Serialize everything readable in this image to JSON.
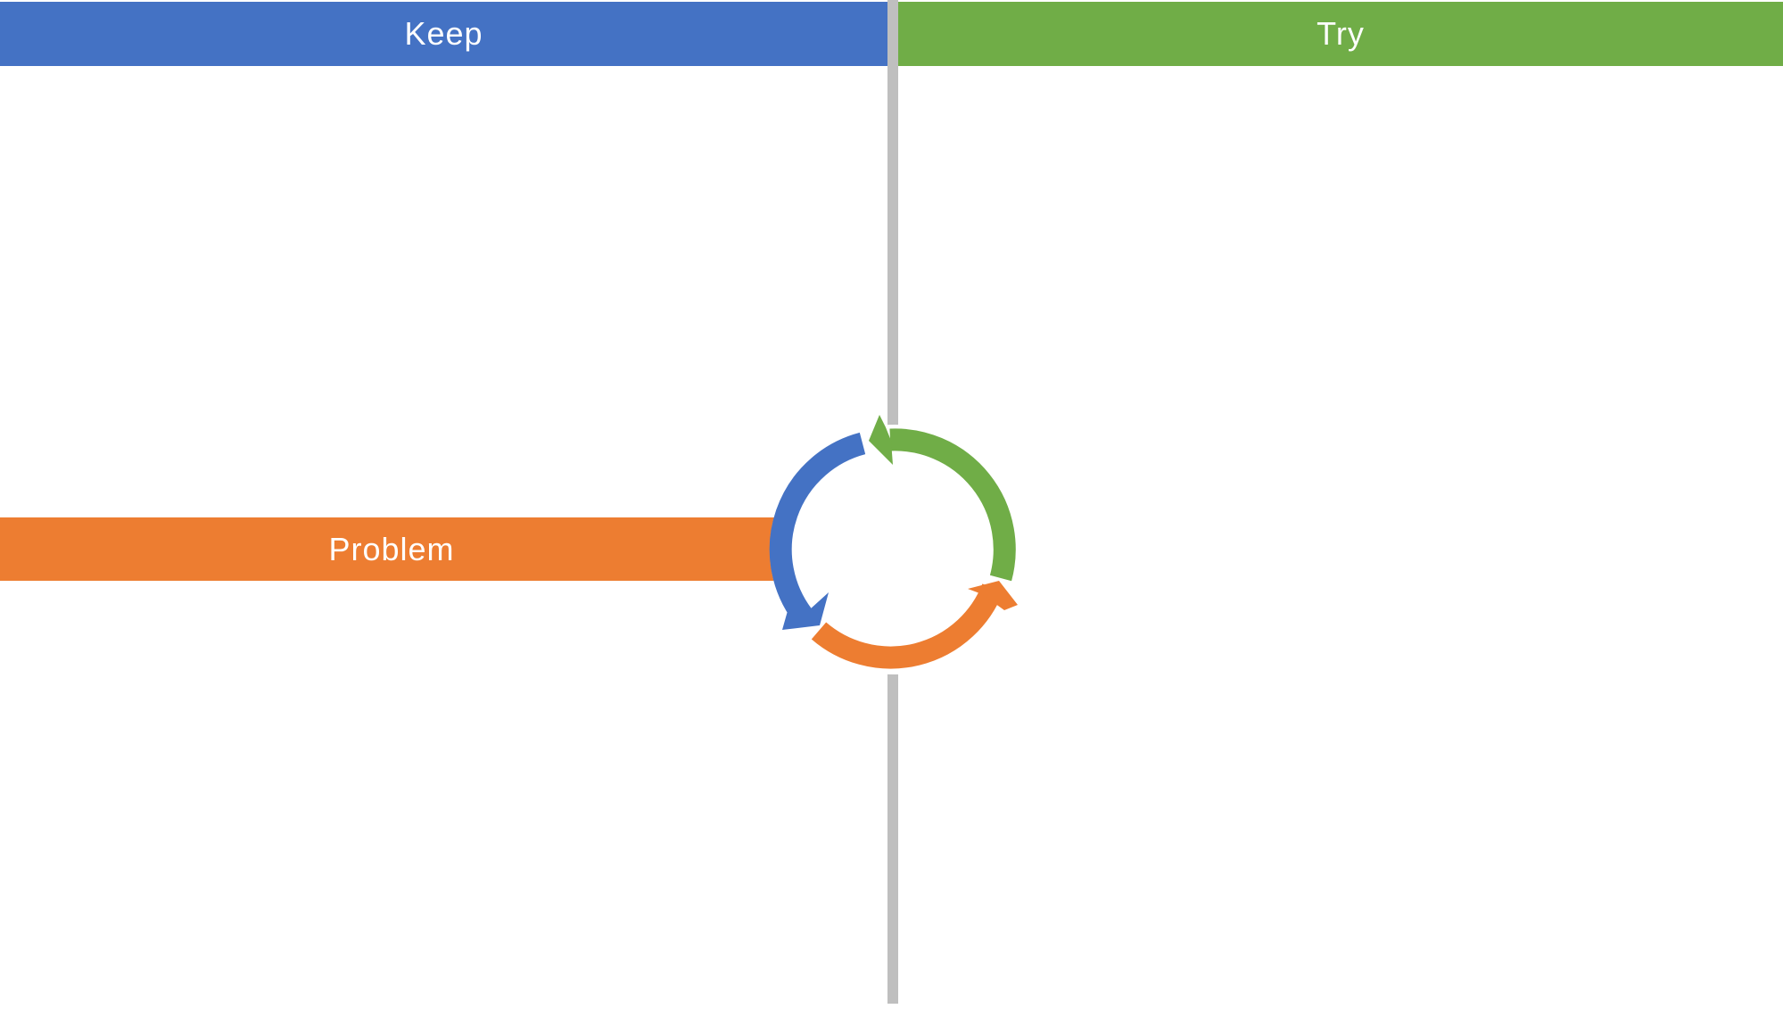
{
  "sections": {
    "keep": {
      "label": "Keep",
      "color": "#4472c4"
    },
    "try": {
      "label": "Try",
      "color": "#70ad47"
    },
    "problem": {
      "label": "Problem",
      "color": "#ed7d31"
    }
  },
  "divider": {
    "color": "#bfbfbf"
  },
  "cycle": {
    "arrows": [
      {
        "name": "keep-to-problem-arrow",
        "color": "#4472c4"
      },
      {
        "name": "problem-to-try-arrow",
        "color": "#ed7d31"
      },
      {
        "name": "try-to-keep-arrow",
        "color": "#70ad47"
      }
    ]
  }
}
